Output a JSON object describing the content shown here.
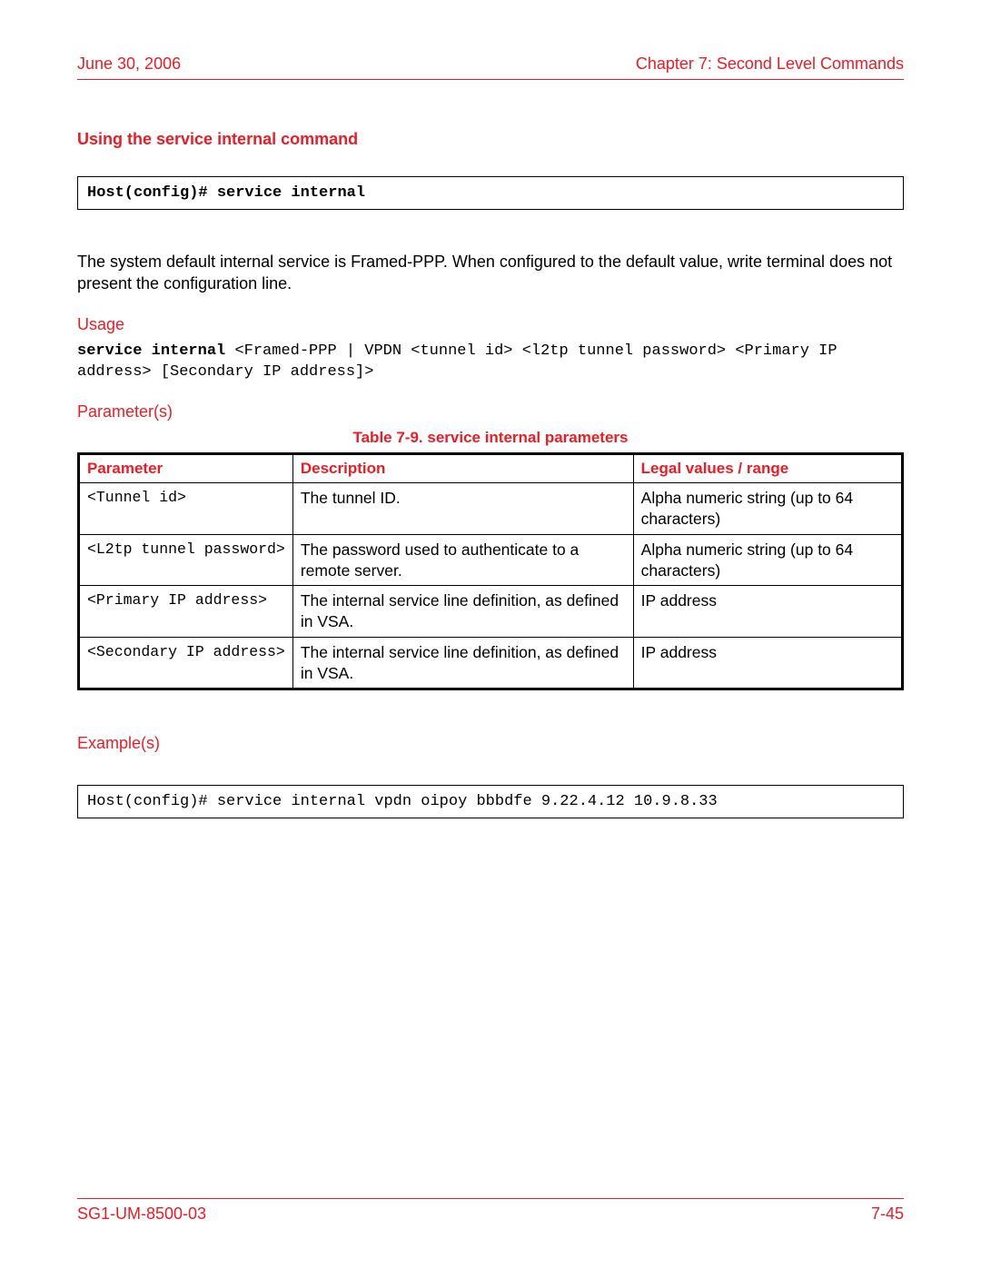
{
  "header": {
    "date": "June 30, 2006",
    "chapter": "Chapter 7: Second Level Commands"
  },
  "section_title": "Using the service internal command",
  "command_box": "Host(config)# service internal",
  "intro_text": "The system default internal service is Framed-PPP. When configured to the default value, write terminal does not present the configuration line.",
  "usage": {
    "label": "Usage",
    "prefix": "service internal ",
    "rest": "<Framed-PPP | VPDN <tunnel id> <l2tp tunnel password> <Primary IP address> [Secondary IP address]>"
  },
  "parameters": {
    "label": "Parameter(s)",
    "caption": "Table 7-9. service internal parameters",
    "headers": {
      "c1": "Parameter",
      "c2": "Description",
      "c3": "Legal values / range"
    },
    "rows": [
      {
        "param": "<Tunnel id>",
        "desc": "The tunnel ID.",
        "legal": "Alpha numeric string (up to 64 characters)"
      },
      {
        "param": "<L2tp tunnel password>",
        "desc": "The password used to authenticate to a remote server.",
        "legal": "Alpha numeric string (up to 64 characters)"
      },
      {
        "param": "<Primary IP address>",
        "desc": "The internal service line definition, as defined in VSA.",
        "legal": "IP address"
      },
      {
        "param": "<Secondary IP address>",
        "desc": "The internal service line definition, as defined in VSA.",
        "legal": "IP address"
      }
    ]
  },
  "examples": {
    "label": "Example(s)",
    "text": "Host(config)# service internal vpdn oipoy bbbdfe 9.22.4.12 10.9.8.33"
  },
  "footer": {
    "doc_id": "SG1-UM-8500-03",
    "page": "7-45"
  }
}
